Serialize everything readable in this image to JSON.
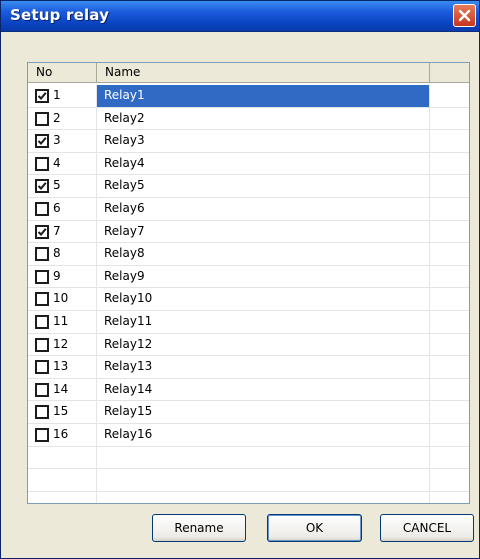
{
  "window": {
    "title": "Setup relay",
    "close_icon": "close-icon",
    "accent": "#0b46c6"
  },
  "list": {
    "columns": [
      "No",
      "Name",
      ""
    ],
    "selected_color": "#316ac5",
    "rows": [
      {
        "no": "1",
        "name": "Relay1",
        "checked": true,
        "selected": true
      },
      {
        "no": "2",
        "name": "Relay2",
        "checked": false,
        "selected": false
      },
      {
        "no": "3",
        "name": "Relay3",
        "checked": true,
        "selected": false
      },
      {
        "no": "4",
        "name": "Relay4",
        "checked": false,
        "selected": false
      },
      {
        "no": "5",
        "name": "Relay5",
        "checked": true,
        "selected": false
      },
      {
        "no": "6",
        "name": "Relay6",
        "checked": false,
        "selected": false
      },
      {
        "no": "7",
        "name": "Relay7",
        "checked": true,
        "selected": false
      },
      {
        "no": "8",
        "name": "Relay8",
        "checked": false,
        "selected": false
      },
      {
        "no": "9",
        "name": "Relay9",
        "checked": false,
        "selected": false
      },
      {
        "no": "10",
        "name": "Relay10",
        "checked": false,
        "selected": false
      },
      {
        "no": "11",
        "name": "Relay11",
        "checked": false,
        "selected": false
      },
      {
        "no": "12",
        "name": "Relay12",
        "checked": false,
        "selected": false
      },
      {
        "no": "13",
        "name": "Relay13",
        "checked": false,
        "selected": false
      },
      {
        "no": "14",
        "name": "Relay14",
        "checked": false,
        "selected": false
      },
      {
        "no": "15",
        "name": "Relay15",
        "checked": false,
        "selected": false
      },
      {
        "no": "16",
        "name": "Relay16",
        "checked": false,
        "selected": false
      }
    ]
  },
  "buttons": {
    "rename": "Rename",
    "ok": "OK",
    "cancel": "CANCEL"
  }
}
